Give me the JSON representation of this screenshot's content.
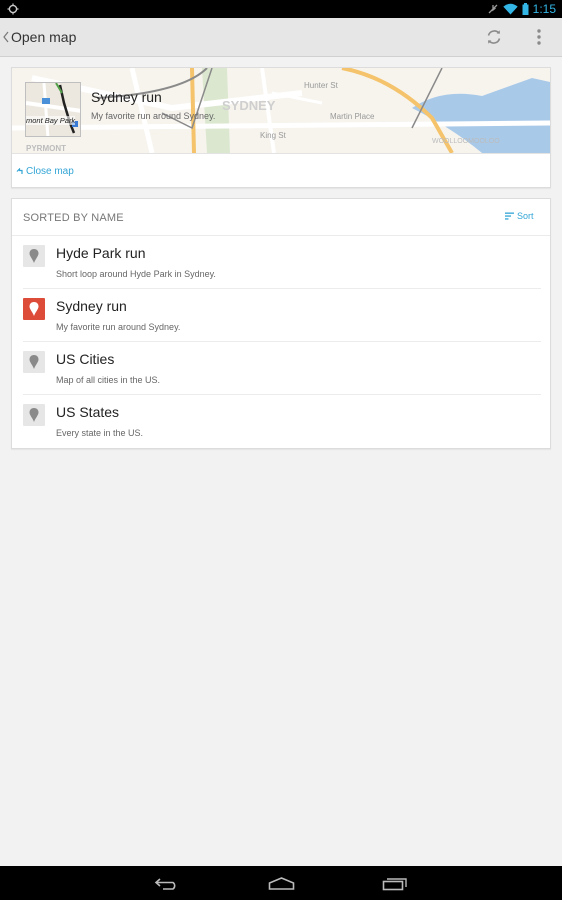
{
  "status_bar": {
    "time": "1:15",
    "left_icon": "notification-ring-icon",
    "icons": [
      "do-not-disturb-icon",
      "wifi-icon",
      "battery-icon"
    ]
  },
  "action_bar": {
    "title": "Open map",
    "refresh_icon": "refresh-icon",
    "overflow_icon": "overflow-menu-icon"
  },
  "map_card": {
    "title": "Sydney run",
    "subtitle": "My favorite run around Sydney.",
    "thumbnail_label": "mont Bay Park",
    "map_labels": [
      "SYDNEY",
      "Hunter St",
      "Martin Place",
      "King St",
      "PYRMONT",
      "WOOLLOOMOOLOO"
    ],
    "close_label": "Close map"
  },
  "list_card": {
    "header": "SORTED BY NAME",
    "sort_label": "Sort",
    "items": [
      {
        "title": "Hyde Park run",
        "subtitle": "Short loop around Hyde Park in Sydney.",
        "selected": false
      },
      {
        "title": "Sydney run",
        "subtitle": "My favorite run around Sydney.",
        "selected": true
      },
      {
        "title": "US Cities",
        "subtitle": "Map of all cities in the US.",
        "selected": false
      },
      {
        "title": "US States",
        "subtitle": "Every state in the US.",
        "selected": false
      }
    ]
  },
  "nav_bar": {
    "buttons": [
      "back-icon",
      "home-icon",
      "recent-apps-icon"
    ]
  },
  "colors": {
    "accent": "#33b5e5",
    "link": "#33a5d6",
    "selected_pin": "#dd4b39",
    "action_bar": "#e6e6e6"
  }
}
